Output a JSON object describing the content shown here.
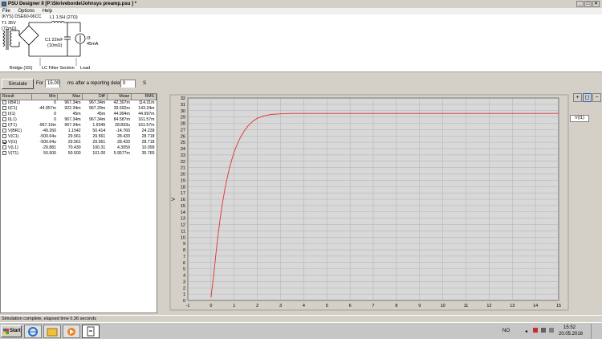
{
  "window": {
    "title": "PSU Designer II  [P:\\Skriveborde\\Johnsys preamp.psu ] *",
    "minimize_glyph": "_",
    "maximize_glyph": "□",
    "close_glyph": "×"
  },
  "menu": [
    "File",
    "Options",
    "Help"
  ],
  "schematic": {
    "rectifier": "(KYS)  DSE60-06CC",
    "transformer": "T1  35V",
    "transformer_r": "(72mΩ)",
    "inductor": "L1  1.5H (27Ω)",
    "capacitor": "C1  22mF",
    "capacitor_esr": "(10mΩ)",
    "load_id": "I3",
    "load_value": "45mA",
    "section_bridge": "Bridge (SS)",
    "section_filter": "LC Filter Section",
    "section_load": "Load"
  },
  "sim": {
    "button": "Simulate",
    "for_label": "For",
    "duration": "15.000",
    "unit_ms": "ms",
    "after_label": "after a reporting delay of",
    "delay": "0",
    "unit_s": "S"
  },
  "results": {
    "headers": [
      "Result",
      "Min",
      "Max",
      "Diff",
      "Mean",
      "RMS"
    ],
    "rows": [
      {
        "name": "I(BR1)",
        "checked": false,
        "min": "0",
        "max": "967.34m",
        "diff": "967.34m",
        "mean": "42.307m",
        "rms": "114.31m"
      },
      {
        "name": "I(C1)",
        "checked": false,
        "min": "-44.957m",
        "max": "922.34m",
        "diff": "967.29m",
        "mean": "39.592m",
        "rms": "143.24m"
      },
      {
        "name": "I(I1)",
        "checked": false,
        "min": "0",
        "max": "45m",
        "diff": "45m",
        "mean": "44.994m",
        "rms": "44.997m"
      },
      {
        "name": "I(L1)",
        "checked": false,
        "min": "0",
        "max": "967.34m",
        "diff": "967.34m",
        "mean": "84.587m",
        "rms": "161.57m"
      },
      {
        "name": "I(T1)",
        "checked": false,
        "min": "-967.19m",
        "max": "967.34m",
        "diff": "1.9345",
        "mean": "28.893u",
        "rms": "161.57m"
      },
      {
        "name": "V(BR1)",
        "checked": false,
        "min": "-49.260",
        "max": "1.1542",
        "diff": "50.414",
        "mean": "-14.760",
        "rms": "24.239"
      },
      {
        "name": "V(C1)",
        "checked": false,
        "min": "-500.64u",
        "max": "29.561",
        "diff": "29.561",
        "mean": "28.433",
        "rms": "28.718"
      },
      {
        "name": "V(I1)",
        "checked": true,
        "min": "-500.64u",
        "max": "29.561",
        "diff": "29.561",
        "mean": "28.433",
        "rms": "28.718"
      },
      {
        "name": "V(L1)",
        "checked": false,
        "min": "-29.881",
        "max": "70.430",
        "diff": "100.31",
        "mean": "4.3059",
        "rms": "10.099"
      },
      {
        "name": "V(T1)",
        "checked": false,
        "min": "50.500",
        "max": "50.500",
        "diff": "101.00",
        "mean": "5.9577m",
        "rms": "35.765"
      }
    ]
  },
  "legend": {
    "label": "V(I1)"
  },
  "zoom": {
    "zoom_in": "+",
    "zoom_fit": "◻",
    "zoom_out": "−"
  },
  "status": "Simulation complete, elapsed time 0.36 seconds",
  "taskbar": {
    "start": "Start",
    "language": "NO",
    "time": "15:52",
    "date": "20.05.2016"
  },
  "chart_data": {
    "type": "line",
    "ylabel": "V",
    "xlim": [
      -1,
      15
    ],
    "ylim": [
      0,
      32
    ],
    "xticks": [
      -1,
      0,
      1,
      2,
      3,
      4,
      5,
      6,
      7,
      8,
      9,
      10,
      11,
      12,
      13,
      14,
      15
    ],
    "yticks": [
      0,
      1,
      2,
      3,
      4,
      5,
      6,
      7,
      8,
      9,
      10,
      11,
      12,
      13,
      14,
      15,
      16,
      17,
      18,
      19,
      20,
      21,
      22,
      23,
      24,
      25,
      26,
      27,
      28,
      29,
      30,
      31,
      32
    ],
    "grid": true,
    "legend_position": "right",
    "line_color": "#e03030",
    "series": [
      {
        "name": "V(I1)",
        "x": [
          0,
          0.1,
          0.2,
          0.3,
          0.4,
          0.5,
          0.6,
          0.7,
          0.8,
          0.9,
          1.0,
          1.2,
          1.4,
          1.6,
          1.8,
          2.0,
          2.3,
          2.6,
          3.0,
          3.5,
          4.0,
          5.0,
          6.0,
          8.0,
          10.0,
          12.0,
          15.0
        ],
        "y": [
          0.5,
          3.5,
          7.0,
          10.2,
          13.0,
          15.5,
          17.6,
          19.4,
          21.0,
          22.3,
          23.5,
          25.3,
          26.6,
          27.6,
          28.3,
          28.8,
          29.2,
          29.4,
          29.5,
          29.56,
          29.56,
          29.56,
          29.56,
          29.56,
          29.56,
          29.56,
          29.56
        ]
      }
    ]
  }
}
